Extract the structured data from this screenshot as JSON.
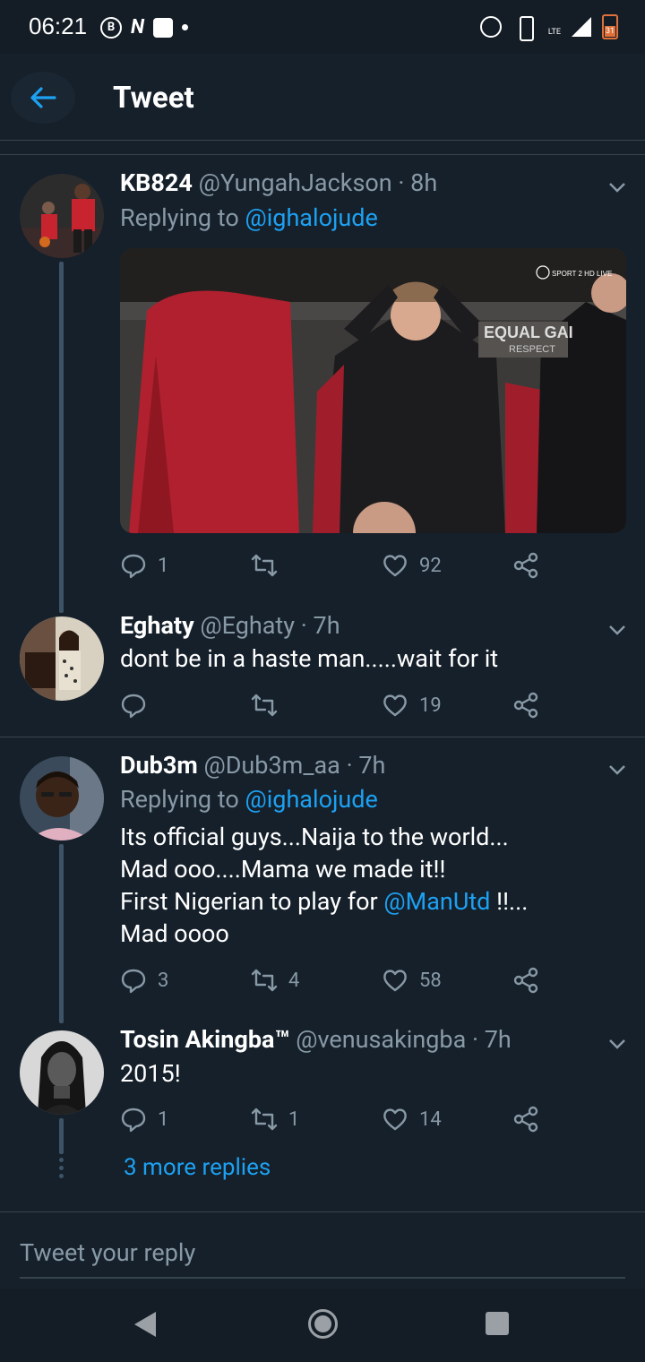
{
  "status_bar": {
    "time": "06:21",
    "left_icons": [
      "b-circle-icon",
      "n-icon",
      "square-icon",
      "dot-icon"
    ],
    "network": "LTE",
    "battery": "31",
    "battery_color": "#e0703a"
  },
  "app_bar": {
    "title": "Tweet",
    "back_icon": "arrow-left-icon",
    "accent": "#1da1f2"
  },
  "tweets": [
    {
      "name": "KB824",
      "handle": "@YungahJackson",
      "time": "8h",
      "replying_label": "Replying to",
      "replying_to": "@ighalojude",
      "media_overlay_text": "EQUAL GAI",
      "media_overlay_sub": "RESPECT",
      "media_logo": "SPORT 2 HD LIVE",
      "counts": {
        "reply": "1",
        "retweet": "",
        "like": "92"
      }
    },
    {
      "name": "Eghaty",
      "handle": "@Eghaty",
      "time": "7h",
      "text": "dont be in a haste man.....wait for it",
      "counts": {
        "reply": "",
        "retweet": "",
        "like": "19"
      }
    },
    {
      "name": "Dub3m",
      "handle": "@Dub3m_aa",
      "time": "7h",
      "replying_label": "Replying to",
      "replying_to": "@ighalojude",
      "line1": "Its official guys...Naija to the world...",
      "line2": "Mad ooo....Mama we made it!!",
      "line3_prefix": "First Nigerian to play for",
      "line3_mention": "@ManUtd",
      "line3_suffix": "!!...",
      "line4": "Mad oooo",
      "counts": {
        "reply": "3",
        "retweet": "4",
        "like": "58"
      }
    },
    {
      "name": "Tosin Akingba™",
      "handle": "@venusakingba",
      "time": "7h",
      "text": "2015!",
      "counts": {
        "reply": "1",
        "retweet": "1",
        "like": "14"
      }
    }
  ],
  "more_replies": "3 more replies",
  "reply_bar": {
    "placeholder": "Tweet your reply"
  },
  "colors": {
    "background": "#15202b",
    "secondary_text": "#8899a6",
    "link": "#1da1f2",
    "divider": "#38444d"
  }
}
